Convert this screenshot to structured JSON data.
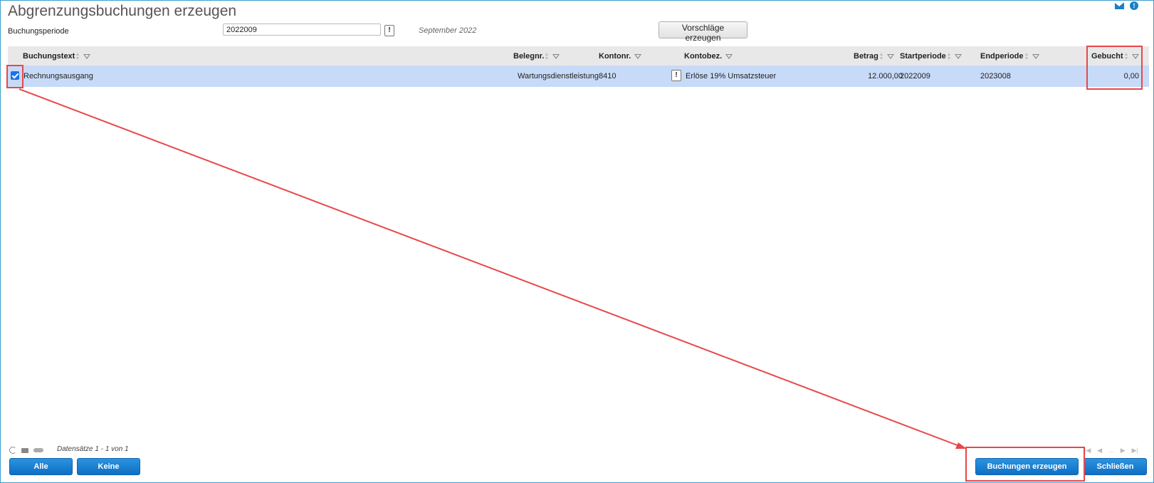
{
  "header": {
    "title": "Abgrenzungsbuchungen erzeugen"
  },
  "form": {
    "period_label": "Buchungsperiode",
    "period_value": "2022009",
    "excl_label": "!",
    "period_text": "September 2022",
    "suggest_button": "Vorschläge erzeugen"
  },
  "grid": {
    "columns": {
      "text": "Buchungstext",
      "belegnr": "Belegnr.",
      "kontonr": "Kontonr.",
      "kontobez": "Kontobez.",
      "betrag": "Betrag",
      "startperiode": "Startperiode",
      "endperiode": "Endperiode",
      "gebucht": "Gebucht"
    },
    "rows": [
      {
        "selected": true,
        "text": "Rechnungsausgang",
        "belegnr": "Wartungsdienstleistung",
        "kontonr": "8410",
        "excl": "!",
        "kontobez": "Erlöse 19% Umsatzsteuer",
        "betrag": "12.000,00",
        "startperiode": "2022009",
        "endperiode": "2023008",
        "gebucht": "0,00"
      }
    ]
  },
  "footer": {
    "records": "Datensätze 1 - 1 von 1",
    "pager_more": "...",
    "all_button": "Alle",
    "none_button": "Keine",
    "create_button": "Buchungen erzeugen",
    "close_button": "Schließen"
  },
  "colors": {
    "accent": "#1a7fc8",
    "selection": "#c7daf7",
    "annotation": "#e8474a"
  }
}
